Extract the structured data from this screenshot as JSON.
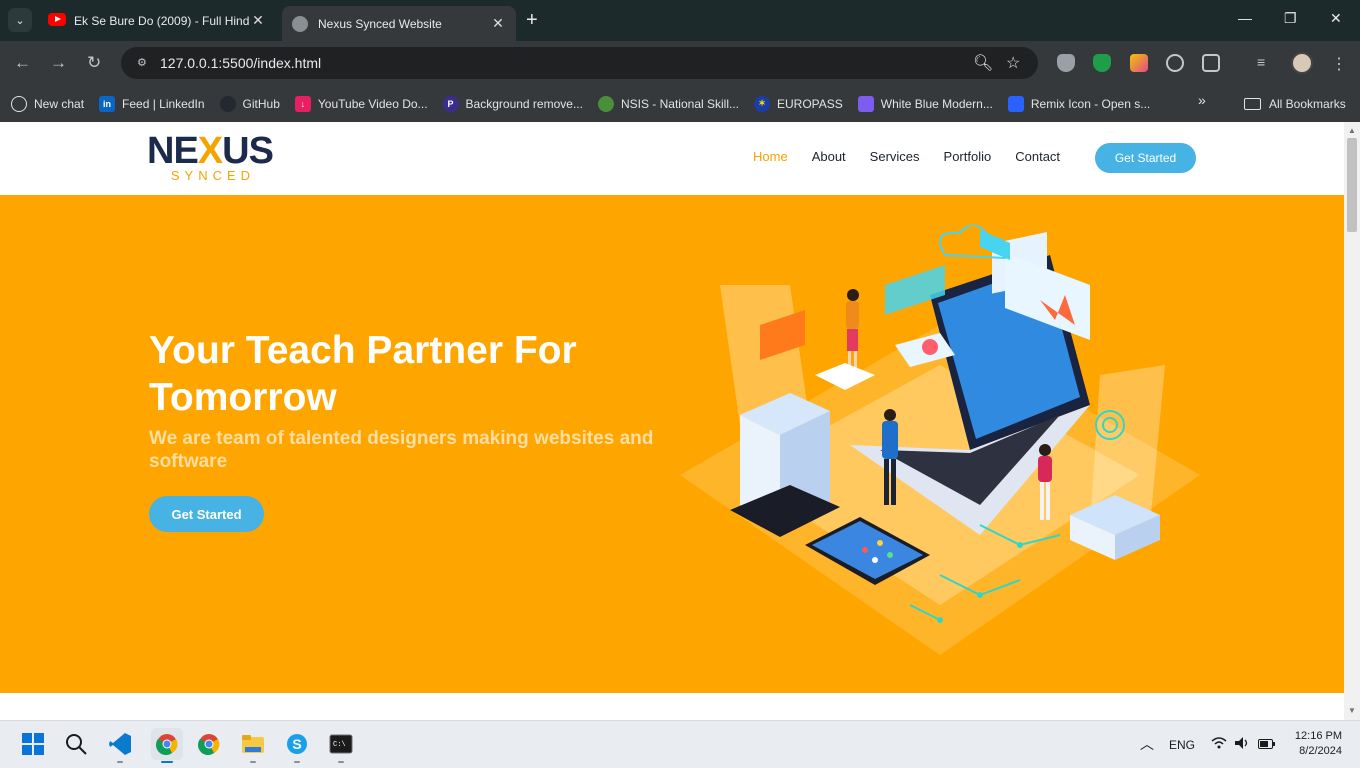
{
  "browser": {
    "tabs": [
      {
        "title": "Ek Se Bure Do (2009) - Full Hindi",
        "favicon": "youtube-icon",
        "active": false
      },
      {
        "title": "Nexus Synced Website",
        "favicon": "globe-icon",
        "active": true
      }
    ],
    "url": "127.0.0.1:5500/index.html",
    "bookmarks": [
      {
        "label": "New chat",
        "icon": "chatgpt-icon",
        "color": "#ffffff"
      },
      {
        "label": "Feed | LinkedIn",
        "icon": "linkedin-icon",
        "color": "#0a66c2"
      },
      {
        "label": "GitHub",
        "icon": "github-icon",
        "color": "#24292f"
      },
      {
        "label": "YouTube Video Do...",
        "icon": "download-icon",
        "color": "#e91e63"
      },
      {
        "label": "Background remove...",
        "icon": "photoroom-icon",
        "color": "#3b2c8f"
      },
      {
        "label": "NSIS - National Skill...",
        "icon": "emblem-icon",
        "color": "#4a8f3a"
      },
      {
        "label": "EUROPASS",
        "icon": "eu-icon",
        "color": "#1a3ea8"
      },
      {
        "label": "White Blue Modern...",
        "icon": "canva-icon",
        "color": "#7d5cf0"
      },
      {
        "label": "Remix Icon - Open s...",
        "icon": "remix-icon",
        "color": "#2962ff"
      }
    ],
    "all_bookmarks_label": "All Bookmarks"
  },
  "site": {
    "logo_main_1": "NE",
    "logo_main_x": "X",
    "logo_main_2": "US",
    "logo_sub": "SYNCED",
    "nav": [
      "Home",
      "About",
      "Services",
      "Portfolio",
      "Contact"
    ],
    "nav_active": "Home",
    "nav_button": "Get Started",
    "hero": {
      "title": "Your Teach Partner For Tomorrow",
      "subtitle": "We are team of talented designers making websites and software",
      "button": "Get Started"
    },
    "colors": {
      "accent": "#f5a300",
      "hero_bg": "#ffa500",
      "button": "#47b2e4",
      "logo_dark": "#1c2b4b"
    }
  },
  "taskbar": {
    "language": "ENG",
    "time": "12:16 PM",
    "date": "8/2/2024",
    "apps": [
      "windows-start-icon",
      "search-icon",
      "vscode-icon",
      "chrome-icon",
      "chrome-icon",
      "file-explorer-icon",
      "skype-icon",
      "terminal-icon"
    ]
  }
}
